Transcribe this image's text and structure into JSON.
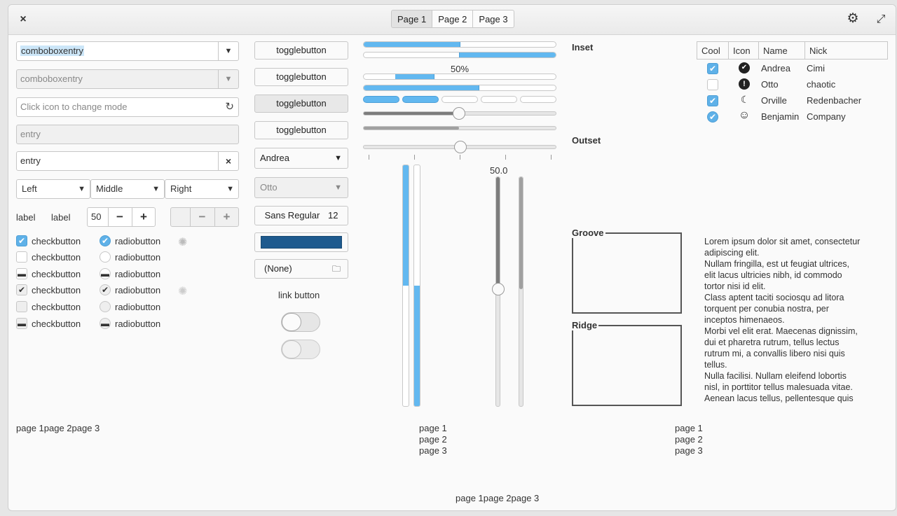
{
  "header": {
    "close_icon": "×",
    "tabs": [
      "Page 1",
      "Page 2",
      "Page 3"
    ],
    "gear_icon": "⚙",
    "expand_icon": "⤢"
  },
  "column1": {
    "combo1_value": "comboboxentry",
    "combo2_value": "comboboxentry",
    "entry_mode_placeholder": "Click icon to change mode",
    "entry_disabled": "entry",
    "entry_clear": "entry",
    "dropdowns": [
      "Left",
      "Middle",
      "Right"
    ],
    "label_a": "label",
    "label_b": "label",
    "spin_value": "50",
    "spin2_value": "",
    "checkbuttons": [
      "checkbutton",
      "checkbutton",
      "checkbutton",
      "checkbutton",
      "checkbutton",
      "checkbutton"
    ],
    "radiobuttons": [
      "radiobutton",
      "radiobutton",
      "radiobutton",
      "radiobutton",
      "radiobutton",
      "radiobutton"
    ],
    "bottom_tabs": "page 1page 2page 3"
  },
  "column2": {
    "togglebuttons": [
      "togglebutton",
      "togglebutton",
      "togglebutton",
      "togglebutton"
    ],
    "combo_andrea": "Andrea",
    "combo_otto": "Otto",
    "font_button": "Sans Regular",
    "font_size": "12",
    "color_button": "#1e5a8e",
    "file_button": "(None)",
    "link_button": "link button",
    "switch1_on": false,
    "switch2_on": false
  },
  "column3": {
    "progress_label": "50%",
    "scale_value_label": "50.0",
    "progress_values": [
      0.5,
      0.5,
      0.2,
      0.6
    ],
    "page_labels": [
      "page 1",
      "page 2",
      "page 3"
    ]
  },
  "column4": {
    "inset_label": "Inset",
    "outset_label": "Outset",
    "groove_label": "Groove",
    "ridge_label": "Ridge",
    "tree_headers": [
      "Cool",
      "Icon",
      "Name",
      "Nick"
    ],
    "tree_rows": [
      {
        "cool": true,
        "icon": "check-circle-icon",
        "glyph": "✔",
        "name": "Andrea",
        "nick": "Cimi"
      },
      {
        "cool": false,
        "icon": "exclamation-icon",
        "glyph": "!",
        "name": "Otto",
        "nick": "chaotic"
      },
      {
        "cool": true,
        "icon": "moon-icon",
        "glyph": "☾",
        "name": "Orville",
        "nick": "Redenbacher"
      },
      {
        "cool": true,
        "icon": "face-icon",
        "glyph": "☺",
        "name": "Benjamin",
        "nick": "Company"
      }
    ],
    "lorem": "Lorem ipsum dolor sit amet, consectetur\nadipiscing elit.\nNullam fringilla, est ut feugiat ultrices,\nelit lacus ultricies nibh, id commodo\ntortor nisi id elit.\nClass aptent taciti sociosqu ad litora\ntorquent per conubia nostra, per\ninceptos himenaeos.\nMorbi vel elit erat. Maecenas dignissim,\ndui et pharetra rutrum, tellus lectus\nrutrum mi, a convallis libero nisi quis\ntellus.\nNulla facilisi. Nullam eleifend lobortis\nnisl, in porttitor tellus malesuada vitae.\nAenean lacus tellus, pellentesque quis",
    "page_labels": [
      "page 1",
      "page 2",
      "page 3"
    ]
  },
  "footer": {
    "tabs_label": "page 1page 2page 3"
  }
}
